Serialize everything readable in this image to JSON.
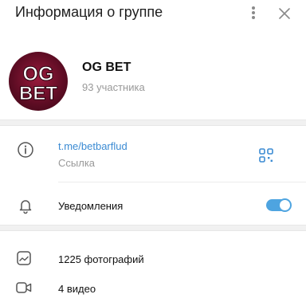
{
  "header": {
    "title": "Информация о группе"
  },
  "group": {
    "name": "OG BET",
    "members": "93 участника",
    "avatar_text_top": "OG",
    "avatar_text_bottom": "BET"
  },
  "info": {
    "link": "t.me/betbarflud",
    "link_caption": "Ссылка",
    "notifications_label": "Уведомления",
    "notifications_enabled": true
  },
  "media": [
    {
      "label": "1225 фотографий",
      "icon": "photo-icon"
    },
    {
      "label": "4 видео",
      "icon": "video-icon"
    }
  ],
  "colors": {
    "accent": "#3b8bd3",
    "toggle": "#4ea4e0",
    "muted_text": "#999999",
    "icon": "#555555"
  }
}
